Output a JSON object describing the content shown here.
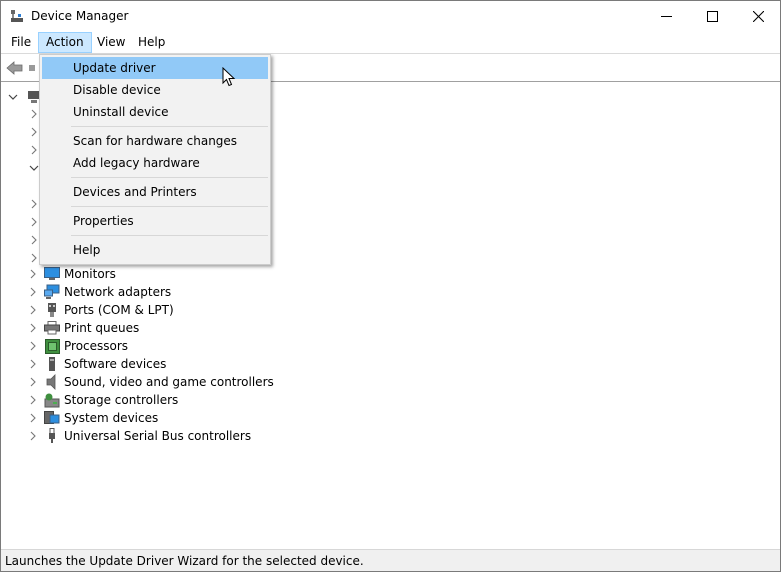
{
  "window": {
    "title": "Device Manager",
    "controls": [
      "minimize",
      "maximize",
      "close"
    ]
  },
  "menubar": {
    "items": [
      "File",
      "Action",
      "View",
      "Help"
    ],
    "active": "Action"
  },
  "dropdown": {
    "items": [
      {
        "label": "Update driver",
        "highlighted": true
      },
      {
        "label": "Disable device"
      },
      {
        "label": "Uninstall device"
      },
      {
        "label": "Scan for hardware changes"
      },
      {
        "label": "Add legacy hardware"
      },
      {
        "label": "Devices and Printers"
      },
      {
        "label": "Properties"
      },
      {
        "label": "Help"
      }
    ]
  },
  "tree": {
    "visible_nodes": [
      {
        "label": "Monitors",
        "icon": "monitor-icon"
      },
      {
        "label": "Network adapters",
        "icon": "network-icon"
      },
      {
        "label": "Ports (COM & LPT)",
        "icon": "port-icon"
      },
      {
        "label": "Print queues",
        "icon": "printer-icon"
      },
      {
        "label": "Processors",
        "icon": "processor-icon"
      },
      {
        "label": "Software devices",
        "icon": "software-device-icon"
      },
      {
        "label": "Sound, video and game controllers",
        "icon": "speaker-icon"
      },
      {
        "label": "Storage controllers",
        "icon": "storage-icon"
      },
      {
        "label": "System devices",
        "icon": "system-device-icon"
      },
      {
        "label": "Universal Serial Bus controllers",
        "icon": "usb-icon"
      }
    ]
  },
  "statusbar": {
    "text": "Launches the Update Driver Wizard for the selected device."
  },
  "colors": {
    "menu_active_bg": "#cce8ff",
    "menu_hover_item": "#91c9f7",
    "menu_bg": "#f2f2f2"
  }
}
